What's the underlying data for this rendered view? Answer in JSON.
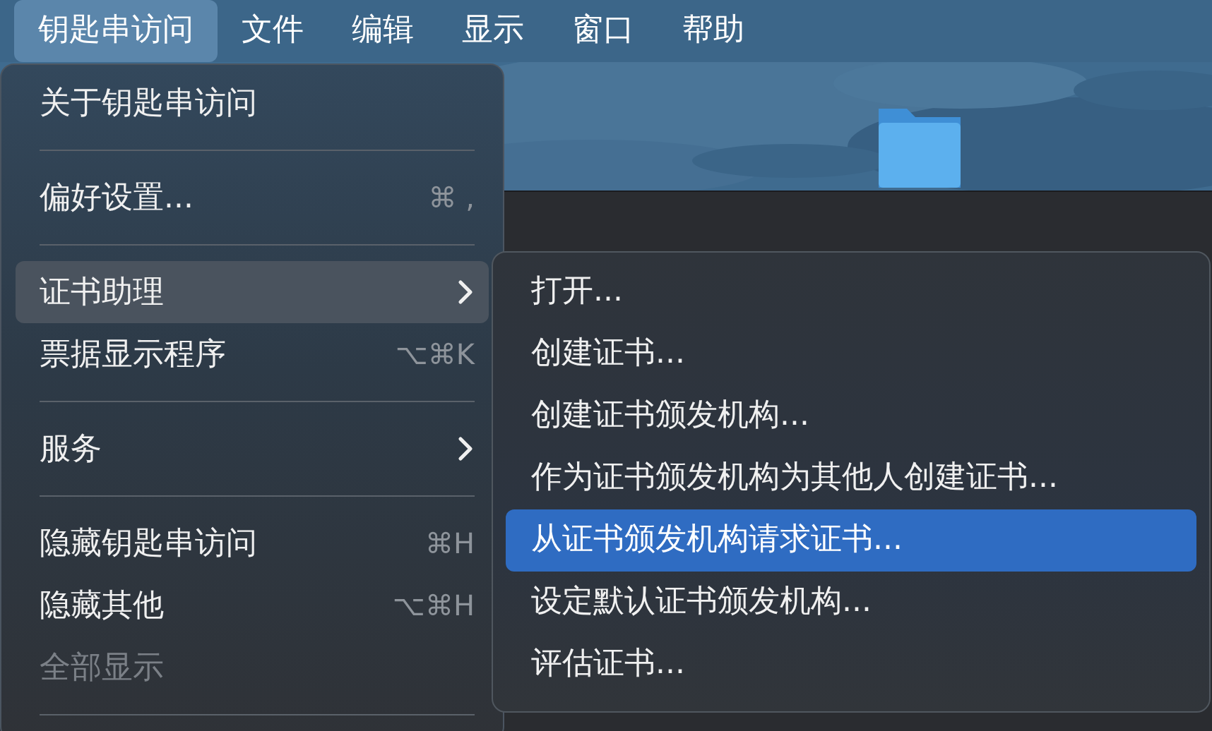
{
  "menu_bar": [
    {
      "label": "钥匙串访问",
      "selected": true
    },
    {
      "label": "文件",
      "selected": false
    },
    {
      "label": "编辑",
      "selected": false
    },
    {
      "label": "显示",
      "selected": false
    },
    {
      "label": "窗口",
      "selected": false
    },
    {
      "label": "帮助",
      "selected": false
    }
  ],
  "app_menu": [
    {
      "kind": "item",
      "label": "关于钥匙串访问",
      "selected": false,
      "disabled": false,
      "submenu": false
    },
    {
      "kind": "separator"
    },
    {
      "kind": "item",
      "label": "偏好设置...",
      "shortcut": "⌘ ,",
      "selected": false,
      "disabled": false,
      "submenu": false
    },
    {
      "kind": "separator"
    },
    {
      "kind": "item",
      "label": "证书助理",
      "selected": true,
      "disabled": false,
      "submenu": true
    },
    {
      "kind": "item",
      "label": "票据显示程序",
      "shortcut": "⌥⌘K",
      "selected": false,
      "disabled": false,
      "submenu": false
    },
    {
      "kind": "separator"
    },
    {
      "kind": "item",
      "label": "服务",
      "selected": false,
      "disabled": false,
      "submenu": true
    },
    {
      "kind": "separator"
    },
    {
      "kind": "item",
      "label": "隐藏钥匙串访问",
      "shortcut": "⌘H",
      "selected": false,
      "disabled": false,
      "submenu": false
    },
    {
      "kind": "item",
      "label": "隐藏其他",
      "shortcut": "⌥⌘H",
      "selected": false,
      "disabled": false,
      "submenu": false
    },
    {
      "kind": "item",
      "label": "全部显示",
      "selected": false,
      "disabled": true,
      "submenu": false
    },
    {
      "kind": "separator"
    }
  ],
  "certificate_assistant_menu": [
    {
      "label": "打开...",
      "selected": false
    },
    {
      "label": "创建证书...",
      "selected": false
    },
    {
      "label": "创建证书颁发机构...",
      "selected": false
    },
    {
      "label": "作为证书颁发机构为其他人创建证书...",
      "selected": false
    },
    {
      "label": "从证书颁发机构请求证书...",
      "selected": true
    },
    {
      "label": "设定默认证书颁发机构...",
      "selected": false
    },
    {
      "label": "评估证书...",
      "selected": false
    }
  ]
}
